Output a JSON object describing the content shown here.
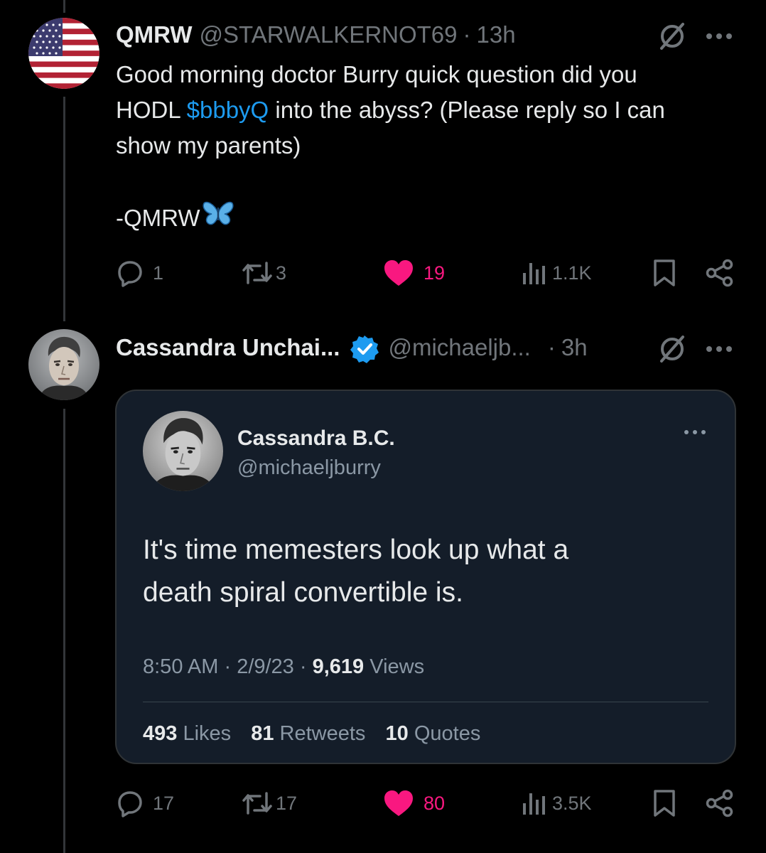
{
  "tweet1": {
    "display_name": "QMRW",
    "handle": "@STARWALKERNOT69",
    "time": "13h",
    "text_line1": "Good morning doctor Burry quick question did you",
    "text_line2_pre": "HODL ",
    "cashtag": "$bbbyQ",
    "text_line2_post": " into the abyss? (Please reply so I can",
    "text_line3": "show my parents)",
    "signature": "-QMRW",
    "replies": "1",
    "retweets": "3",
    "likes": "19",
    "views": "1.1K"
  },
  "tweet2": {
    "display_name": "Cassandra Unchai...",
    "handle": "@michaeljb...",
    "time": "3h",
    "replies": "17",
    "retweets": "17",
    "likes": "80",
    "views": "3.5K",
    "quoted": {
      "display_name": "Cassandra B.C.",
      "handle": "@michaeljburry",
      "text_line1": "It's time memesters look up what a",
      "text_line2": "death spiral convertible is.",
      "time": "8:50 AM",
      "date": "2/9/23",
      "views_count": "9,619",
      "views_label": "Views",
      "likes_count": "493",
      "likes_label": "Likes",
      "retweets_count": "81",
      "retweets_label": "Retweets",
      "quotes_count": "10",
      "quotes_label": "Quotes"
    }
  },
  "colors": {
    "accent_blue": "#1d9bf0",
    "like_pink": "#f91880",
    "muted": "#71767b",
    "background": "#000000",
    "quote_background": "#141d29"
  },
  "icons": [
    "reply-icon",
    "retweet-icon",
    "like-icon",
    "views-icon",
    "bookmark-icon",
    "share-icon",
    "more-icon",
    "grok-icon",
    "verified-icon",
    "butterfly-icon",
    "flag-icon"
  ]
}
